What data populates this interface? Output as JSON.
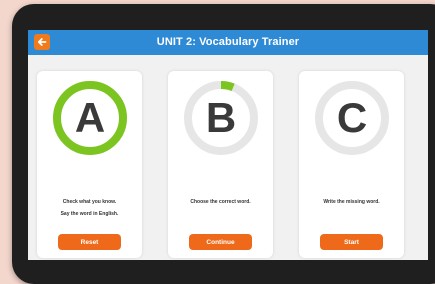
{
  "header": {
    "title": "UNIT 2: Vocabulary Trainer",
    "back_icon": "arrow-left-icon"
  },
  "colors": {
    "title_bar": "#2f8ad6",
    "accent_orange": "#ee6a1a",
    "progress_green": "#7cc521",
    "ring_grey": "#e6e6e6"
  },
  "cards": [
    {
      "letter": "A",
      "progress": 1.0,
      "text_line1": "Check what you know.",
      "text_line2": "Say the word in English.",
      "button": "Reset"
    },
    {
      "letter": "B",
      "progress": 0.06,
      "text_line1": "Choose the correct word.",
      "button": "Continue"
    },
    {
      "letter": "C",
      "progress": 0,
      "text_line1": "Write the missing word.",
      "button": "Start"
    }
  ]
}
